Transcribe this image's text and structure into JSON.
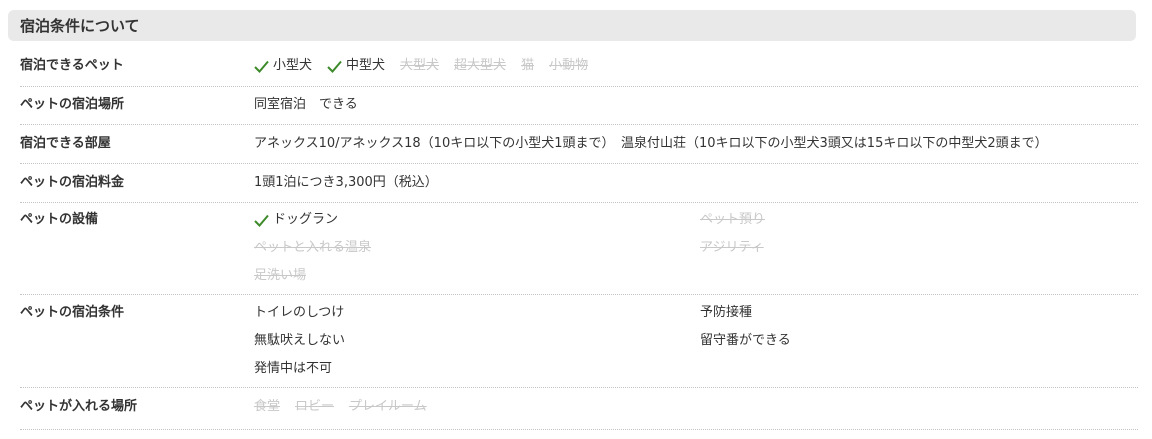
{
  "section": {
    "title": "宿泊条件について"
  },
  "colors": {
    "check": "#3d8a2a",
    "disabled_text": "#c8c8c8",
    "header_bg": "#e9e9e9"
  },
  "rows": {
    "pet_types": {
      "label": "宿泊できるペット",
      "tags": [
        {
          "text": "小型犬",
          "available": true
        },
        {
          "text": "中型犬",
          "available": true
        },
        {
          "text": "大型犬",
          "available": false
        },
        {
          "text": "超大型犬",
          "available": false
        },
        {
          "text": "猫",
          "available": false
        },
        {
          "text": "小動物",
          "available": false
        }
      ]
    },
    "location": {
      "label": "ペットの宿泊場所",
      "value": "同室宿泊　できる"
    },
    "rooms": {
      "label": "宿泊できる部屋",
      "value": "アネックス10/アネックス18（10キロ以下の小型犬1頭まで）　温泉付山荘（10キロ以下の小型犬3頭又は15キロ以下の中型犬2頭まで）"
    },
    "fee": {
      "label": "ペットの宿泊料金",
      "value": "1頭1泊につき3,300円（税込）"
    },
    "facilities": {
      "label": "ペットの設備",
      "items": [
        {
          "text": "ドッグラン",
          "available": true
        },
        {
          "text": "ペット預り",
          "available": false
        },
        {
          "text": "ペットと入れる温泉",
          "available": false
        },
        {
          "text": "アジリティ",
          "available": false
        },
        {
          "text": "足洗い場",
          "available": false
        }
      ]
    },
    "conditions": {
      "label": "ペットの宿泊条件",
      "items": [
        "トイレのしつけ",
        "予防接種",
        "無駄吠えしない",
        "留守番ができる",
        "発情中は不可"
      ]
    },
    "allowed_places": {
      "label": "ペットが入れる場所",
      "tags": [
        {
          "text": "食堂",
          "available": false
        },
        {
          "text": "ロビー",
          "available": false
        },
        {
          "text": "プレイルーム",
          "available": false
        }
      ]
    }
  }
}
